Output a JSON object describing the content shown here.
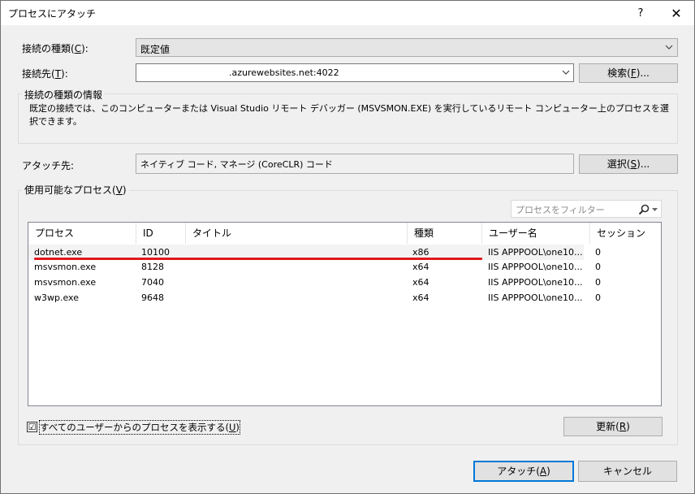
{
  "window": {
    "title": "プロセスにアタッチ",
    "help_label": "?",
    "close_label": "✕"
  },
  "connection": {
    "type_label": "接続の種類(",
    "type_key": "C",
    "type_label_end": "):",
    "type_value": "既定値",
    "target_label": "接続先(",
    "target_key": "T",
    "target_label_end": "):",
    "target_value": ".azurewebsites.net:4022",
    "find_button": "検索(",
    "find_key": "F",
    "find_button_end": ")..."
  },
  "info": {
    "heading": "接続の種類の情報",
    "text": "既定の接続では、このコンピューターまたは Visual Studio リモート デバッガー (MSVSMON.EXE) を実行しているリモート コンピューター上のプロセスを選択できます。"
  },
  "attach_to": {
    "label": "アタッチ先:",
    "value": "ネイティブ コード, マネージ (CoreCLR) コード",
    "select_button": "選択(",
    "select_key": "S",
    "select_button_end": ")..."
  },
  "processes": {
    "group_label": "使用可能なプロセス(",
    "group_key": "V",
    "group_label_end": ")",
    "filter_placeholder": "プロセスをフィルター",
    "columns": [
      "プロセス",
      "ID",
      "タイトル",
      "種類",
      "ユーザー名",
      "セッション"
    ],
    "rows": [
      {
        "name": "dotnet.exe",
        "id": "10100",
        "title": "",
        "type": "x86",
        "user": "IIS APPPOOL\\one10...",
        "session": "0"
      },
      {
        "name": "msvsmon.exe",
        "id": "8128",
        "title": "",
        "type": "x64",
        "user": "IIS APPPOOL\\one10...",
        "session": "0"
      },
      {
        "name": "msvsmon.exe",
        "id": "7040",
        "title": "",
        "type": "x64",
        "user": "IIS APPPOOL\\one10...",
        "session": "0"
      },
      {
        "name": "w3wp.exe",
        "id": "9648",
        "title": "",
        "type": "x64",
        "user": "IIS APPPOOL\\one10...",
        "session": "0"
      }
    ],
    "show_all_label": "すべてのユーザーからのプロセスを表示する(",
    "show_all_key": "U",
    "show_all_label_end": ")",
    "show_all_checked": "☑",
    "refresh_button": "更新(",
    "refresh_key": "R",
    "refresh_button_end": ")"
  },
  "footer": {
    "attach_button": "アタッチ(",
    "attach_key": "A",
    "attach_button_end": ")",
    "cancel_button": "キャンセル"
  },
  "colors": {
    "accent": "#0078d7",
    "highlight_line": "#e0191e"
  },
  "icons": {
    "search": "search-icon",
    "dropdown": "chevron-down-icon"
  }
}
